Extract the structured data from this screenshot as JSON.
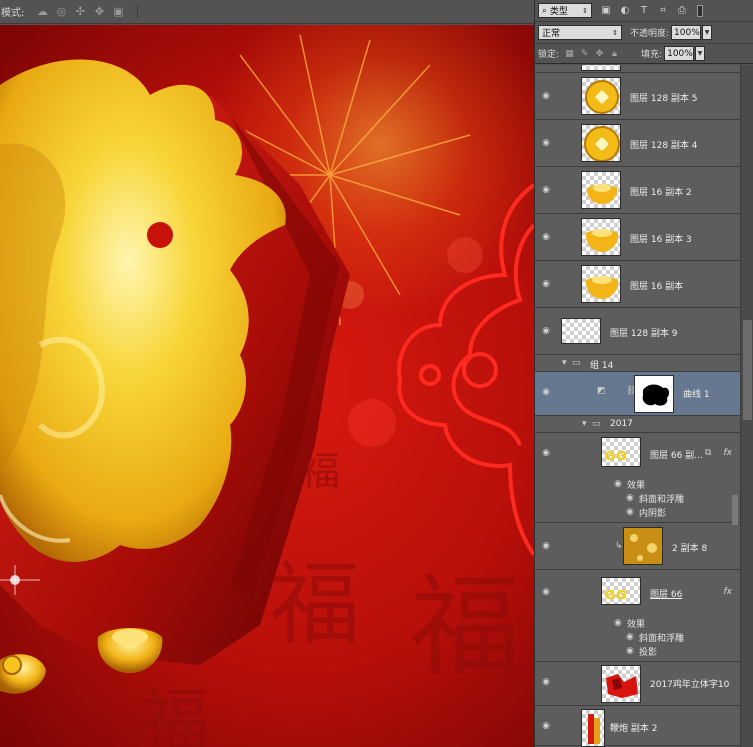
{
  "options_bar": {
    "mode_label": "模式:"
  },
  "layers_panel": {
    "filter_kind": "类型",
    "blend_mode": "正常",
    "opacity_label": "不透明度:",
    "opacity_value": "100%",
    "lock_label": "锁定:",
    "fill_label": "填充:",
    "fill_value": "100%",
    "layers": [
      {
        "name": "图层 128 副本 5"
      },
      {
        "name": "图层 128 副本 4"
      },
      {
        "name": "图层 16 副本 2"
      },
      {
        "name": "图层 16 副本 3"
      },
      {
        "name": "图层 16 副本"
      },
      {
        "name": "图层 128 副本 9"
      },
      {
        "name": "组 14"
      },
      {
        "name": "曲线 1"
      },
      {
        "name": "2017"
      },
      {
        "name": "图层 66 副...",
        "effects_label": "效果",
        "effects": [
          "斜面和浮雕",
          "内阴影"
        ]
      },
      {
        "name": "2 副本 8"
      },
      {
        "name": "图层 66",
        "effects_label": "效果",
        "effects": [
          "斜面和浮雕",
          "投影"
        ]
      },
      {
        "name": "2017鸡年立体字10"
      },
      {
        "name": "鞭炮 副本 2"
      }
    ]
  },
  "colors": {
    "canvas_red": "#c8130c",
    "gold": "#f6c21a",
    "selected_row": "#66788f"
  }
}
